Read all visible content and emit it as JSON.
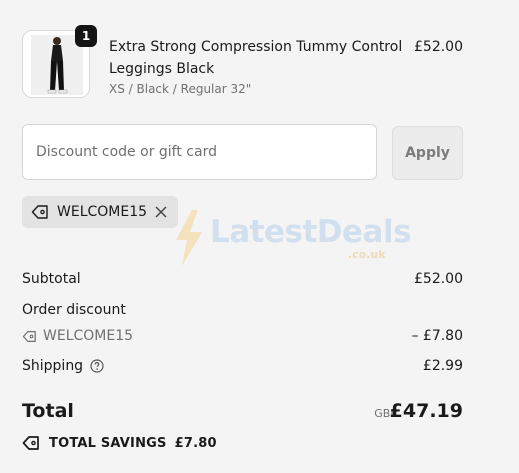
{
  "line_item": {
    "quantity": "1",
    "name": "Extra Strong Compression Tummy Control Leggings Black",
    "variant": "XS / Black / Regular 32\"",
    "price": "£52.00",
    "image_icon": "leggings-product-thumbnail"
  },
  "discount": {
    "placeholder": "Discount code or gift card",
    "value": "",
    "apply_label": "Apply"
  },
  "applied_code": {
    "code": "WELCOME15",
    "icon": "tag-icon",
    "remove_icon": "close-icon"
  },
  "watermark": {
    "brand": "LatestDeals",
    "sub": ".co.uk"
  },
  "summary": {
    "subtotal_label": "Subtotal",
    "subtotal_value": "£52.00",
    "order_discount_label": "Order discount",
    "order_discount_code": "WELCOME15",
    "order_discount_value": "– £7.80",
    "shipping_label": "Shipping",
    "shipping_value": "£2.99",
    "total_label": "Total",
    "currency": "GBP",
    "total_value": "£47.19",
    "savings_label": "TOTAL SAVINGS",
    "savings_value": "£7.80"
  },
  "colors": {
    "background": "#f4f4f4",
    "badge": "#141414",
    "muted_text": "#707070"
  }
}
